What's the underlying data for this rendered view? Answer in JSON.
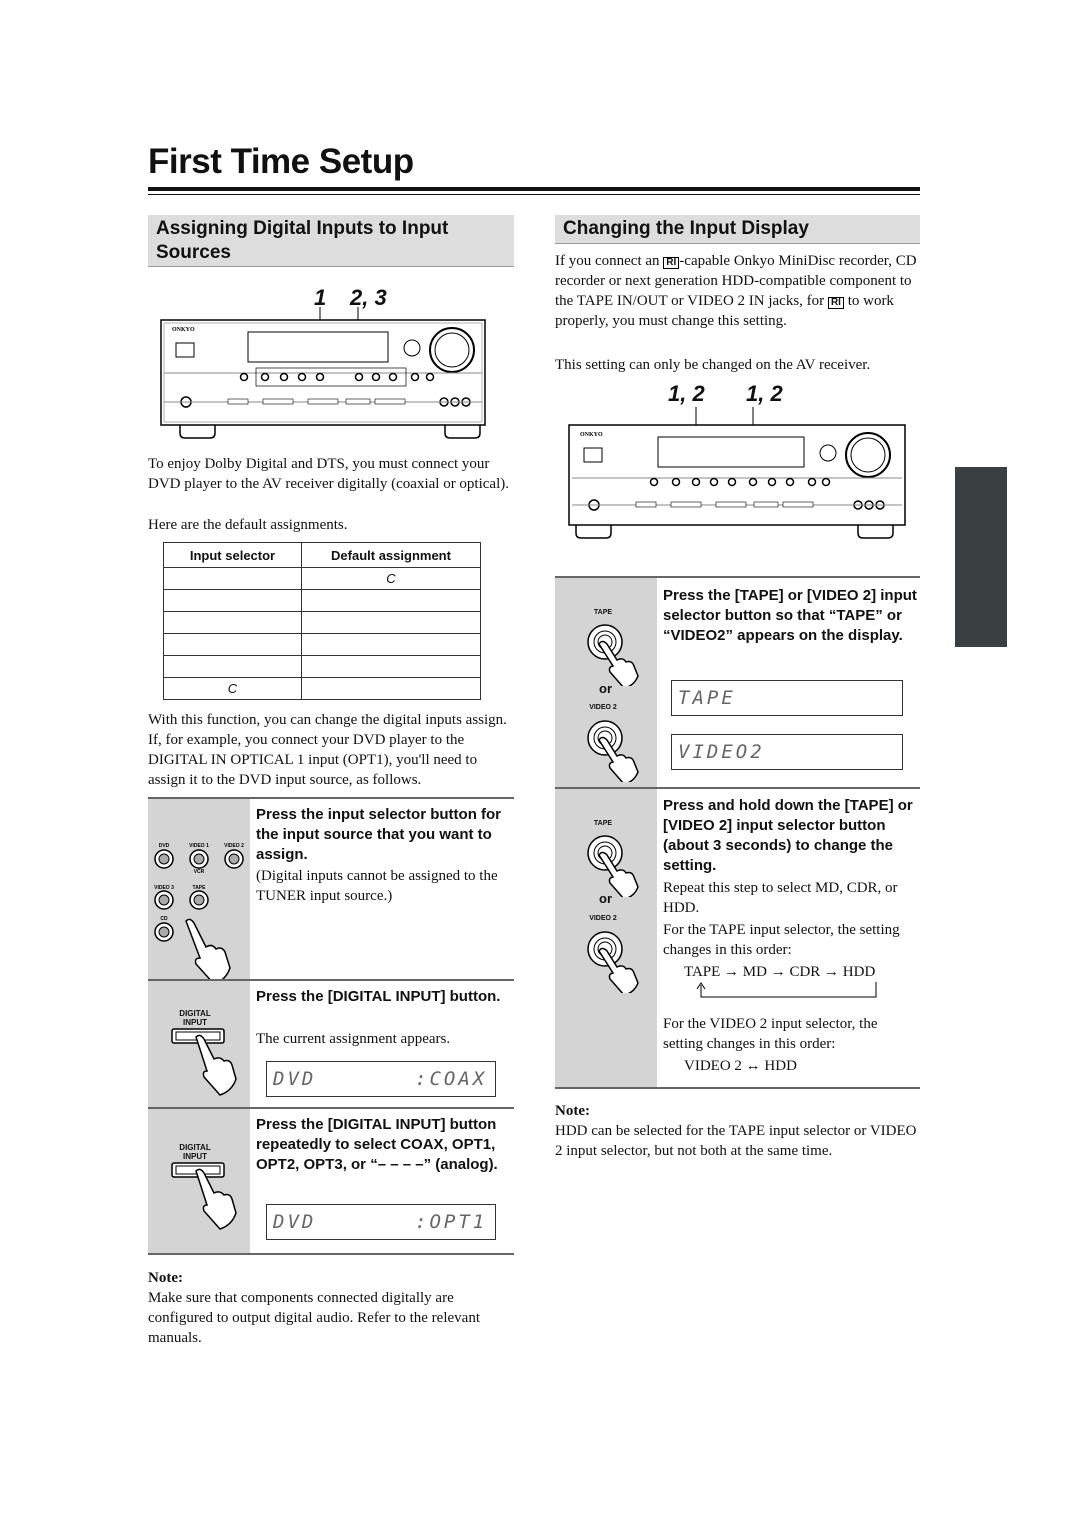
{
  "page": {
    "title": "First Time Setup"
  },
  "left": {
    "heading": "Assigning Digital Inputs to Input Sources",
    "figure_steps": {
      "a": "1",
      "b": "2, 3"
    },
    "intro": "To enjoy Dolby Digital and DTS, you must connect your DVD player to the AV receiver digitally (coaxial or optical).",
    "defaults_intro": "Here are the default assignments.",
    "table": {
      "headers": [
        "Input selector",
        "Default assignment"
      ],
      "rows": [
        [
          "",
          "C"
        ],
        [
          "",
          ""
        ],
        [
          "",
          ""
        ],
        [
          "",
          ""
        ],
        [
          "",
          ""
        ],
        [
          "C",
          ""
        ]
      ]
    },
    "explain": "With this function, you can change the digital inputs assign. If, for example, you connect your DVD player to the DIGITAL IN OPTICAL 1 input (OPT1), you'll need to assign it to the DVD input source, as follows.",
    "steps": [
      {
        "heading": "Press the input selector button for the input source that you want to assign.",
        "text": "(Digital inputs cannot be assigned to the TUNER input source.)",
        "buttons": [
          "DVD",
          "VIDEO 1",
          "VIDEO 2",
          "VCR",
          "VIDEO 3",
          "TAPE",
          "CD"
        ]
      },
      {
        "heading": "Press the [DIGITAL INPUT] button.",
        "text": "The current assignment appears.",
        "button_label": "DIGITAL INPUT",
        "display": {
          "left": "DVD",
          "right": ":COAX"
        }
      },
      {
        "heading": "Press the [DIGITAL INPUT] button repeatedly to select COAX, OPT1, OPT2, OPT3, or “– – – –” (analog).",
        "button_label": "DIGITAL INPUT",
        "display": {
          "left": "DVD",
          "right": ":OPT1"
        }
      }
    ],
    "note_title": "Note:",
    "note": "Make sure that components connected digitally are configured to output digital audio. Refer to the relevant manuals."
  },
  "right": {
    "heading": "Changing the Input Display",
    "intro_a": "If you connect an",
    "intro_b": "-capable Onkyo MiniDisc recorder, CD recorder or next generation HDD-compatible component to the TAPE IN/OUT or VIDEO 2 IN jacks, for",
    "intro_c": "to work properly, you must change this setting.",
    "ri_logo": "RI",
    "only": "This setting can only be changed on the AV receiver.",
    "figure_steps": {
      "a": "1, 2",
      "b": "1, 2"
    },
    "steps": [
      {
        "heading": "Press the [TAPE] or [VIDEO 2] input selector button so that “TAPE” or “VIDEO2” appears on the display.",
        "btn1": "TAPE",
        "or": "or",
        "btn2": "VIDEO 2",
        "displays": [
          "TAPE",
          "VIDEO2"
        ]
      },
      {
        "heading": "Press and hold down the [TAPE] or [VIDEO 2] input selector button (about 3 seconds) to change the setting.",
        "btn1": "TAPE",
        "or": "or",
        "btn2": "VIDEO 2",
        "text1": "Repeat this step to select MD, CDR, or HDD.",
        "text2": "For the TAPE input selector, the setting changes in this order:",
        "order_tape": "TAPE → MD → CDR → HDD",
        "text3": "For the VIDEO 2 input selector, the setting changes in this order:",
        "order_video2": "VIDEO 2 ↔ HDD"
      }
    ],
    "note_title": "Note:",
    "note": "HDD can be selected for the TAPE input selector or VIDEO 2 input selector, but not both at the same time."
  },
  "receiver": {
    "brand": "ONKYO"
  }
}
